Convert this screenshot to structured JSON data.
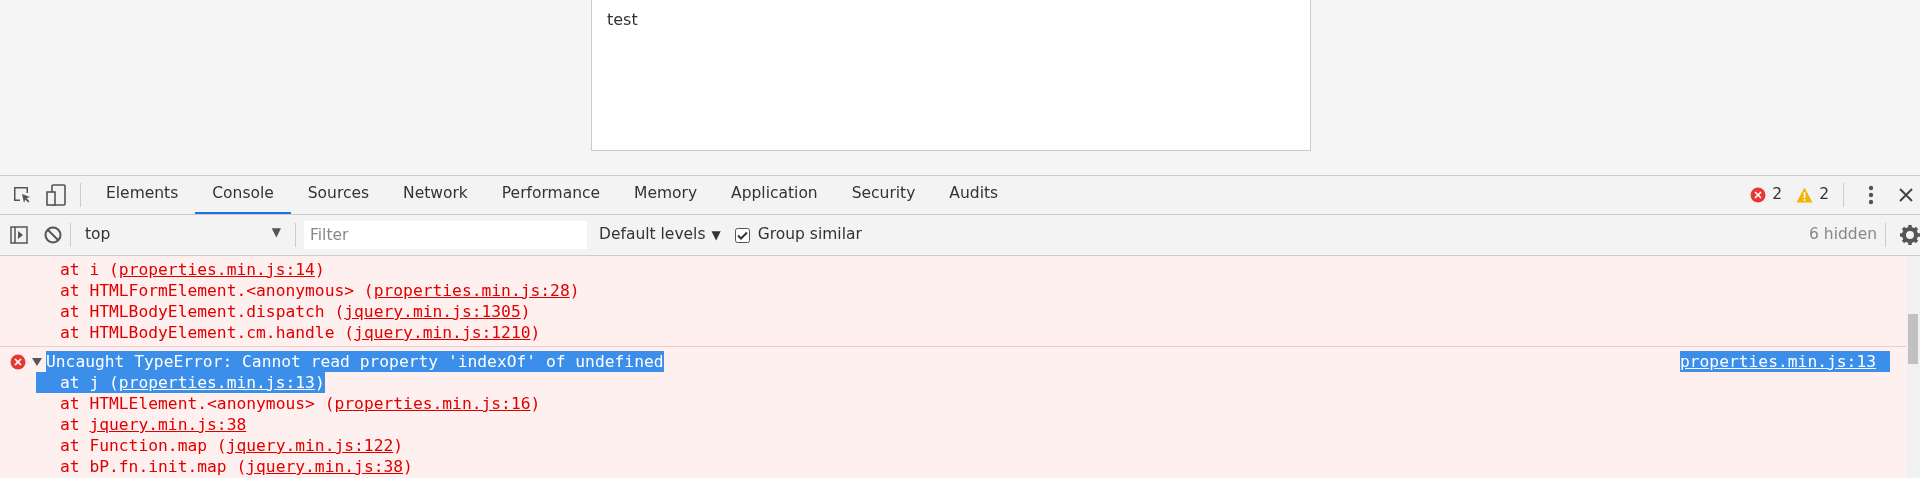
{
  "page": {
    "text": "test"
  },
  "devtools": {
    "tabs": [
      {
        "label": "Elements",
        "selected": false
      },
      {
        "label": "Console",
        "selected": true
      },
      {
        "label": "Sources",
        "selected": false
      },
      {
        "label": "Network",
        "selected": false
      },
      {
        "label": "Performance",
        "selected": false
      },
      {
        "label": "Memory",
        "selected": false
      },
      {
        "label": "Application",
        "selected": false
      },
      {
        "label": "Security",
        "selected": false
      },
      {
        "label": "Audits",
        "selected": false
      }
    ],
    "error_count": "2",
    "warning_count": "2"
  },
  "toolbar": {
    "context": "top",
    "context_caret": "▼",
    "filter_placeholder": "Filter",
    "levels": "Default levels",
    "levels_caret": "▼",
    "group_similar": {
      "label": "Group similar",
      "checked": true
    },
    "hidden": "6 hidden"
  },
  "messages": [
    {
      "kind": "continuation",
      "stack": [
        {
          "before": "at i (",
          "link": "properties.min.js:14",
          "after": ")",
          "selected": false
        },
        {
          "before": "at HTMLFormElement.<anonymous> (",
          "link": "properties.min.js:28",
          "after": ")",
          "selected": false
        },
        {
          "before": "at HTMLBodyElement.dispatch (",
          "link": "jquery.min.js:1305",
          "after": ")",
          "selected": false
        },
        {
          "before": "at HTMLBodyElement.cm.handle (",
          "link": "jquery.min.js:1210",
          "after": ")",
          "selected": false
        }
      ]
    },
    {
      "kind": "error",
      "expanded": true,
      "selected": true,
      "text": "Uncaught TypeError: Cannot read property 'indexOf' of undefined",
      "source": "properties.min.js:13",
      "stack": [
        {
          "before": "at j (",
          "link": "properties.min.js:13",
          "after": ")",
          "selected": true
        },
        {
          "before": "at HTMLElement.<anonymous> (",
          "link": "properties.min.js:16",
          "after": ")",
          "selected": false
        },
        {
          "before": "at ",
          "link": "jquery.min.js:38",
          "selected": false
        },
        {
          "before": "at Function.map (",
          "link": "jquery.min.js:122",
          "after": ")",
          "selected": false
        },
        {
          "before": "at bP.fn.init.map (",
          "link": "jquery.min.js:38",
          "after": ")",
          "selected": false
        }
      ]
    }
  ]
}
